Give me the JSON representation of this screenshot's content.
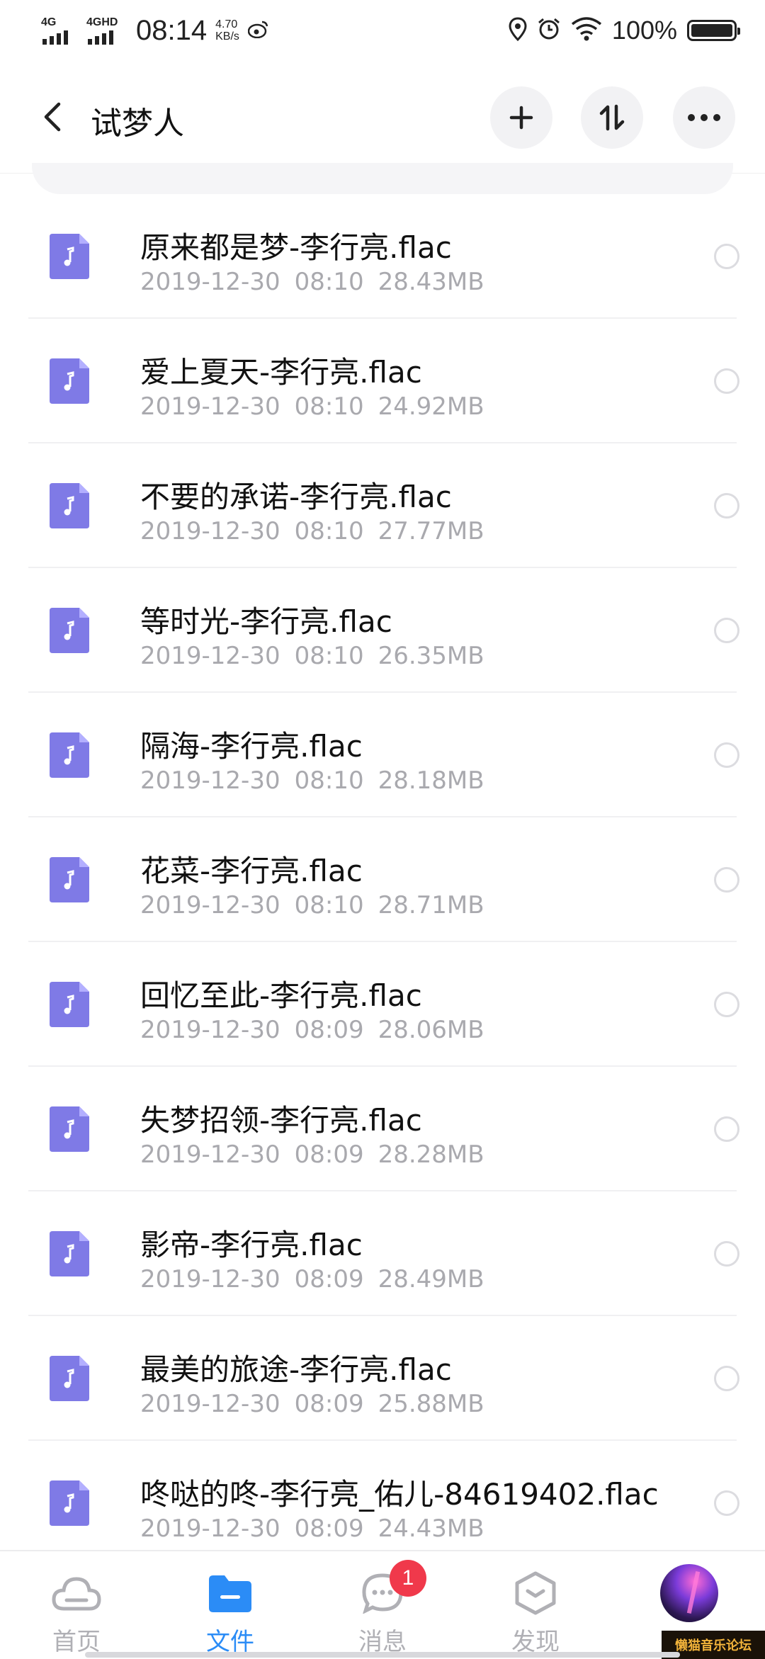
{
  "status_bar": {
    "sim1": "4G",
    "sim2": "4GHD",
    "time": "08:14",
    "speed_value": "4.70",
    "speed_unit": "KB/s",
    "battery": "100%",
    "icons": [
      "weibo-icon",
      "location-icon",
      "alarm-icon",
      "wifi-icon",
      "battery-icon"
    ]
  },
  "header": {
    "title": "试梦人",
    "actions": [
      "back-icon",
      "add-icon",
      "sort-icon",
      "more-icon"
    ]
  },
  "files": [
    {
      "name": "原来都是梦-李行亮.flac",
      "date": "2019-12-30",
      "time": "08:10",
      "size": "28.43MB"
    },
    {
      "name": "爱上夏天-李行亮.flac",
      "date": "2019-12-30",
      "time": "08:10",
      "size": "24.92MB"
    },
    {
      "name": "不要的承诺-李行亮.flac",
      "date": "2019-12-30",
      "time": "08:10",
      "size": "27.77MB"
    },
    {
      "name": "等时光-李行亮.flac",
      "date": "2019-12-30",
      "time": "08:10",
      "size": "26.35MB"
    },
    {
      "name": "隔海-李行亮.flac",
      "date": "2019-12-30",
      "time": "08:10",
      "size": "28.18MB"
    },
    {
      "name": "花菜-李行亮.flac",
      "date": "2019-12-30",
      "time": "08:10",
      "size": "28.71MB"
    },
    {
      "name": "回忆至此-李行亮.flac",
      "date": "2019-12-30",
      "time": "08:09",
      "size": "28.06MB"
    },
    {
      "name": "失梦招领-李行亮.flac",
      "date": "2019-12-30",
      "time": "08:09",
      "size": "28.28MB"
    },
    {
      "name": "影帝-李行亮.flac",
      "date": "2019-12-30",
      "time": "08:09",
      "size": "28.49MB"
    },
    {
      "name": "最美的旅途-李行亮.flac",
      "date": "2019-12-30",
      "time": "08:09",
      "size": "25.88MB"
    },
    {
      "name": "咚哒的咚-李行亮_佑儿-84619402.flac",
      "date": "2019-12-30",
      "time": "08:09",
      "size": "24.43MB"
    }
  ],
  "bottom_nav": {
    "items": [
      {
        "label": "首页",
        "icon": "cloud-icon"
      },
      {
        "label": "文件",
        "icon": "folder-icon"
      },
      {
        "label": "消息",
        "icon": "chat-icon",
        "badge": "1"
      },
      {
        "label": "发现",
        "icon": "discover-icon"
      }
    ],
    "active_index": 1
  },
  "watermark": "懒猫音乐论坛",
  "colors": {
    "accent": "#2b8cf6",
    "file_icon": "#7f7ae6",
    "badge": "#f0394b",
    "meta_text": "#a9a9ae"
  }
}
